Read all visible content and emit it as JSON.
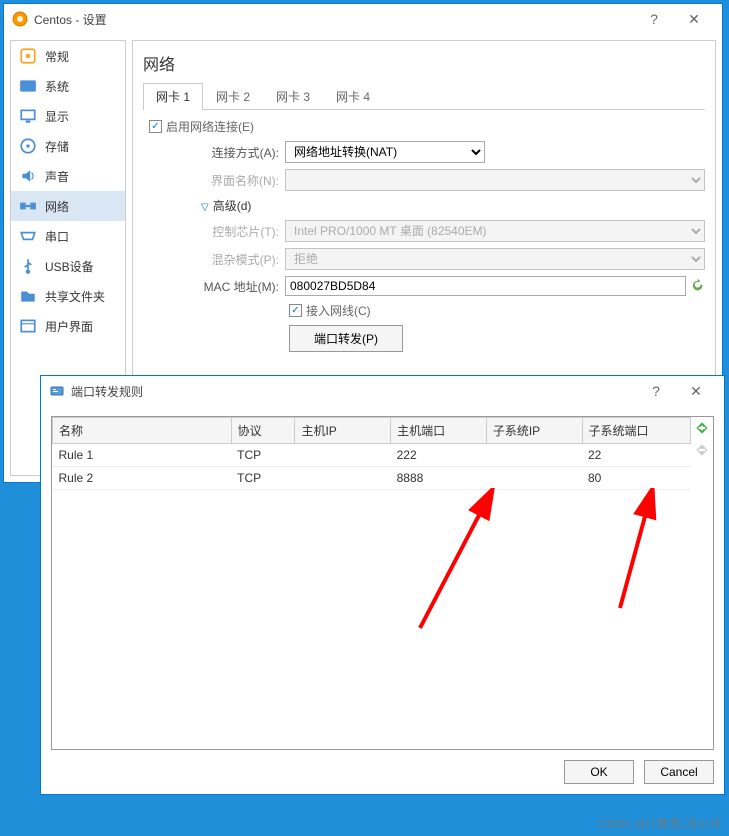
{
  "main_window": {
    "title": "Centos - 设置",
    "sidebar": {
      "items": [
        {
          "label": "常规",
          "icon": "general"
        },
        {
          "label": "系统",
          "icon": "system"
        },
        {
          "label": "显示",
          "icon": "display"
        },
        {
          "label": "存储",
          "icon": "storage"
        },
        {
          "label": "声音",
          "icon": "audio"
        },
        {
          "label": "网络",
          "icon": "network"
        },
        {
          "label": "串口",
          "icon": "serial"
        },
        {
          "label": "USB设备",
          "icon": "usb"
        },
        {
          "label": "共享文件夹",
          "icon": "shared"
        },
        {
          "label": "用户界面",
          "icon": "ui"
        }
      ],
      "selected_index": 5
    },
    "content": {
      "title": "网络",
      "tabs": [
        "网卡 1",
        "网卡 2",
        "网卡 3",
        "网卡 4"
      ],
      "active_tab": 0,
      "enable_label": "启用网络连接(E)",
      "enable_checked": true,
      "connect_label": "连接方式(A):",
      "connect_value": "网络地址转换(NAT)",
      "ifname_label": "界面名称(N):",
      "ifname_value": "",
      "advanced_label": "高级(d)",
      "chip_label": "控制芯片(T):",
      "chip_value": "Intel PRO/1000 MT 桌面 (82540EM)",
      "mix_label": "混杂模式(P):",
      "mix_value": "拒绝",
      "mac_label": "MAC 地址(M):",
      "mac_value": "080027BD5D84",
      "cable_label": "接入网线(C)",
      "cable_checked": true,
      "portfwd_btn": "端口转发(P)"
    }
  },
  "dialog": {
    "title": "端口转发规则",
    "columns": [
      "名称",
      "协议",
      "主机IP",
      "主机端口",
      "子系统IP",
      "子系统端口"
    ],
    "rows": [
      {
        "name": "Rule 1",
        "proto": "TCP",
        "hostip": "",
        "hostport": "222",
        "guestip": "",
        "guestport": "22"
      },
      {
        "name": "Rule 2",
        "proto": "TCP",
        "hostip": "",
        "hostport": "8888",
        "guestip": "",
        "guestport": "80"
      }
    ],
    "ok_label": "OK",
    "cancel_label": "Cancel"
  },
  "watermark": "CSDN @IT教育-汤小洋"
}
